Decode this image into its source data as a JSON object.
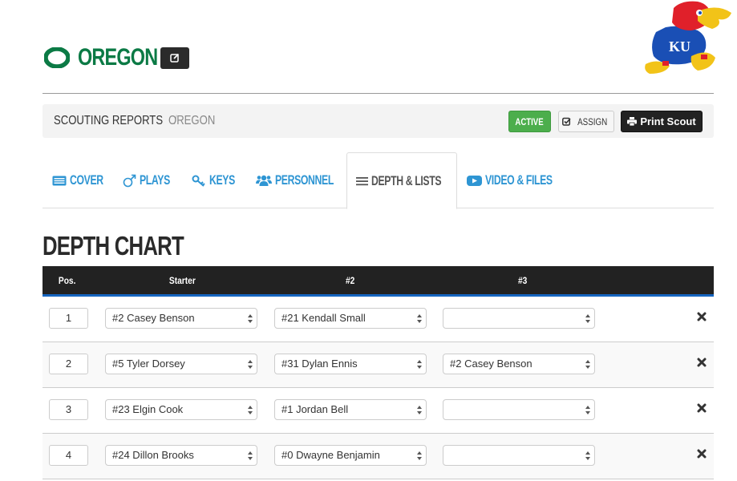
{
  "header": {
    "team_name": "OREGON",
    "team_logo_icon": "oregon-o-logo",
    "edit_icon": "edit-icon",
    "opponent_logo": "kansas-jayhawk-logo"
  },
  "breadcrumb": {
    "items": [
      "SCOUTING REPORTS",
      "OREGON"
    ],
    "separator": "/"
  },
  "actions": {
    "status_label": "ACTIVE",
    "assign_label": "ASSIGN",
    "print_label": "Print Scout"
  },
  "tabs": [
    {
      "label": "COVER",
      "icon": "list-alt-icon",
      "active": false
    },
    {
      "label": "PLAYS",
      "icon": "male-icon",
      "active": false
    },
    {
      "label": "KEYS",
      "icon": "key-icon",
      "active": false
    },
    {
      "label": "PERSONNEL",
      "icon": "users-icon",
      "active": false
    },
    {
      "label": "DEPTH & LISTS",
      "icon": "bars-icon",
      "active": true
    },
    {
      "label": "VIDEO & FILES",
      "icon": "play-icon",
      "active": false
    }
  ],
  "depth_chart": {
    "title": "DEPTH CHART",
    "columns": [
      "Pos.",
      "Starter",
      "#2",
      "#3"
    ],
    "rows": [
      {
        "pos": "1",
        "starter": "#2 Casey Benson",
        "second": "#21 Kendall Small",
        "third": ""
      },
      {
        "pos": "2",
        "starter": "#5 Tyler Dorsey",
        "second": "#31 Dylan Ennis",
        "third": "#2 Casey Benson"
      },
      {
        "pos": "3",
        "starter": "#23 Elgin Cook",
        "second": "#1 Jordan Bell",
        "third": ""
      },
      {
        "pos": "4",
        "starter": "#24 Dillon Brooks",
        "second": "#0 Dwayne Benjamin",
        "third": ""
      }
    ]
  },
  "colors": {
    "oregon_green": "#0b7a45",
    "tab_blue": "#2e95d3",
    "active_green": "#4cae4c",
    "header_accent": "#1565c0"
  }
}
